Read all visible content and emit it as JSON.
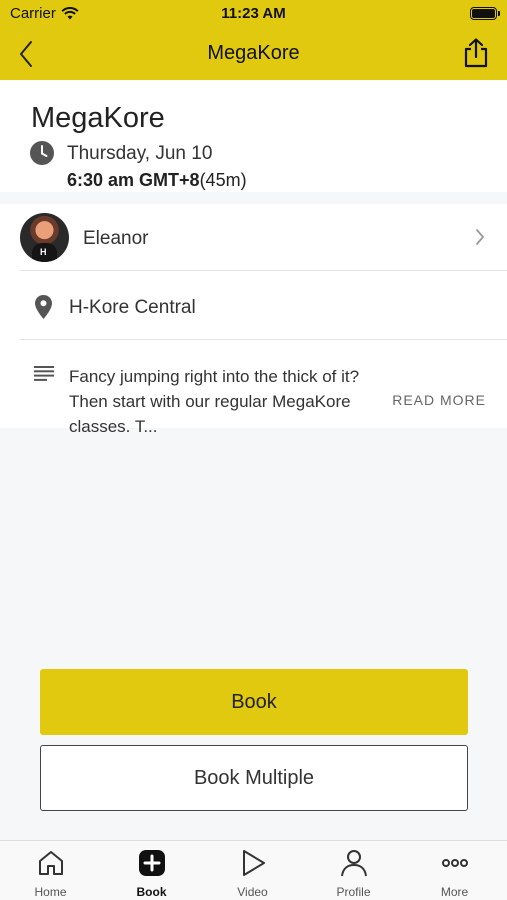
{
  "status_bar": {
    "carrier": "Carrier",
    "time": "11:23 AM"
  },
  "nav": {
    "title": "MegaKore"
  },
  "class": {
    "title": "MegaKore",
    "date": "Thursday, Jun 10",
    "time": "6:30 am GMT+8",
    "duration": "(45m)"
  },
  "instructor": {
    "name": "Eleanor",
    "avatar_letter": "H"
  },
  "location": {
    "name": "H-Kore Central"
  },
  "description": {
    "text": "Fancy jumping right into the thick of it? Then start with our regular MegaKore classes. T...",
    "read_more": "READ MORE"
  },
  "buttons": {
    "book": "Book",
    "book_multiple": "Book Multiple"
  },
  "tabs": [
    {
      "label": "Home",
      "icon": "home-icon"
    },
    {
      "label": "Book",
      "icon": "plus-square-icon"
    },
    {
      "label": "Video",
      "icon": "play-icon"
    },
    {
      "label": "Profile",
      "icon": "person-icon"
    },
    {
      "label": "More",
      "icon": "more-dots-icon"
    }
  ],
  "colors": {
    "accent": "#e0c90f"
  }
}
